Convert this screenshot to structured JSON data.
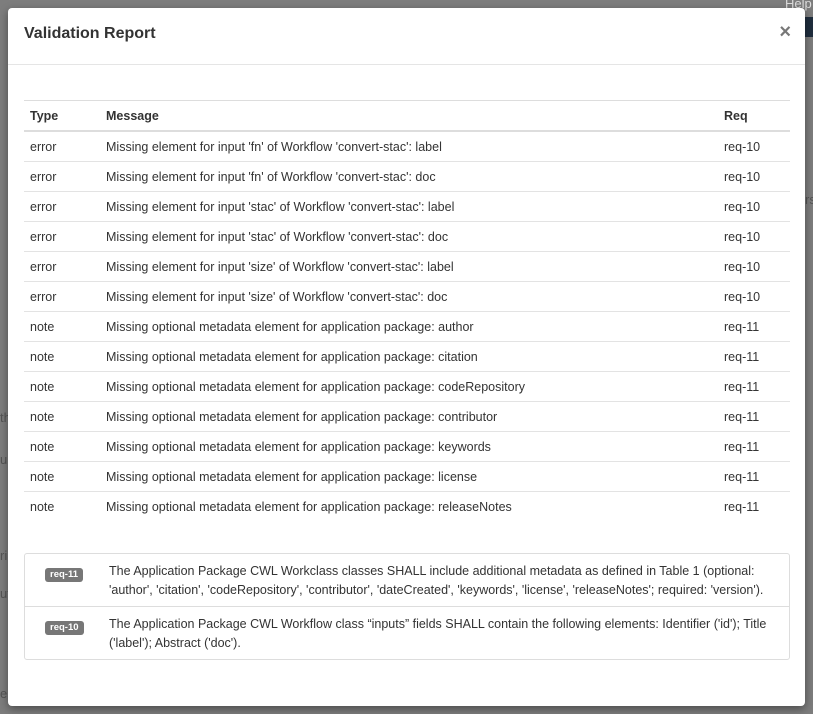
{
  "background": {
    "help_text": "Help",
    "frag_th": "th",
    "frag_u": "u",
    "frag_ri": "ri",
    "frag_ut": "ut",
    "frag_e": "e",
    "frag_rs": "rs"
  },
  "modal": {
    "title": "Validation Report",
    "close_label": "×"
  },
  "table": {
    "headers": [
      "Type",
      "Message",
      "Req"
    ],
    "rows": [
      {
        "type": "error",
        "message": "Missing element for input 'fn' of Workflow 'convert-stac': label",
        "req": "req-10"
      },
      {
        "type": "error",
        "message": "Missing element for input 'fn' of Workflow 'convert-stac': doc",
        "req": "req-10"
      },
      {
        "type": "error",
        "message": "Missing element for input 'stac' of Workflow 'convert-stac': label",
        "req": "req-10"
      },
      {
        "type": "error",
        "message": "Missing element for input 'stac' of Workflow 'convert-stac': doc",
        "req": "req-10"
      },
      {
        "type": "error",
        "message": "Missing element for input 'size' of Workflow 'convert-stac': label",
        "req": "req-10"
      },
      {
        "type": "error",
        "message": "Missing element for input 'size' of Workflow 'convert-stac': doc",
        "req": "req-10"
      },
      {
        "type": "note",
        "message": "Missing optional metadata element for application package: author",
        "req": "req-11"
      },
      {
        "type": "note",
        "message": "Missing optional metadata element for application package: citation",
        "req": "req-11"
      },
      {
        "type": "note",
        "message": "Missing optional metadata element for application package: codeRepository",
        "req": "req-11"
      },
      {
        "type": "note",
        "message": "Missing optional metadata element for application package: contributor",
        "req": "req-11"
      },
      {
        "type": "note",
        "message": "Missing optional metadata element for application package: keywords",
        "req": "req-11"
      },
      {
        "type": "note",
        "message": "Missing optional metadata element for application package: license",
        "req": "req-11"
      },
      {
        "type": "note",
        "message": "Missing optional metadata element for application package: releaseNotes",
        "req": "req-11"
      }
    ]
  },
  "requirements": [
    {
      "id": "req-11",
      "text": "The Application Package CWL Workclass classes SHALL include additional metadata as defined in Table 1 (optional: 'author', 'citation', 'codeRepository', 'contributor', 'dateCreated', 'keywords', 'license', 'releaseNotes'; required: 'version')."
    },
    {
      "id": "req-10",
      "text": "The Application Package CWL Workflow class “inputs” fields SHALL contain the following elements: Identifier ('id'); Title ('label'); Abstract ('doc')."
    }
  ],
  "colors": {
    "badge": "#777777",
    "backdrop": "#7d7d7d"
  }
}
